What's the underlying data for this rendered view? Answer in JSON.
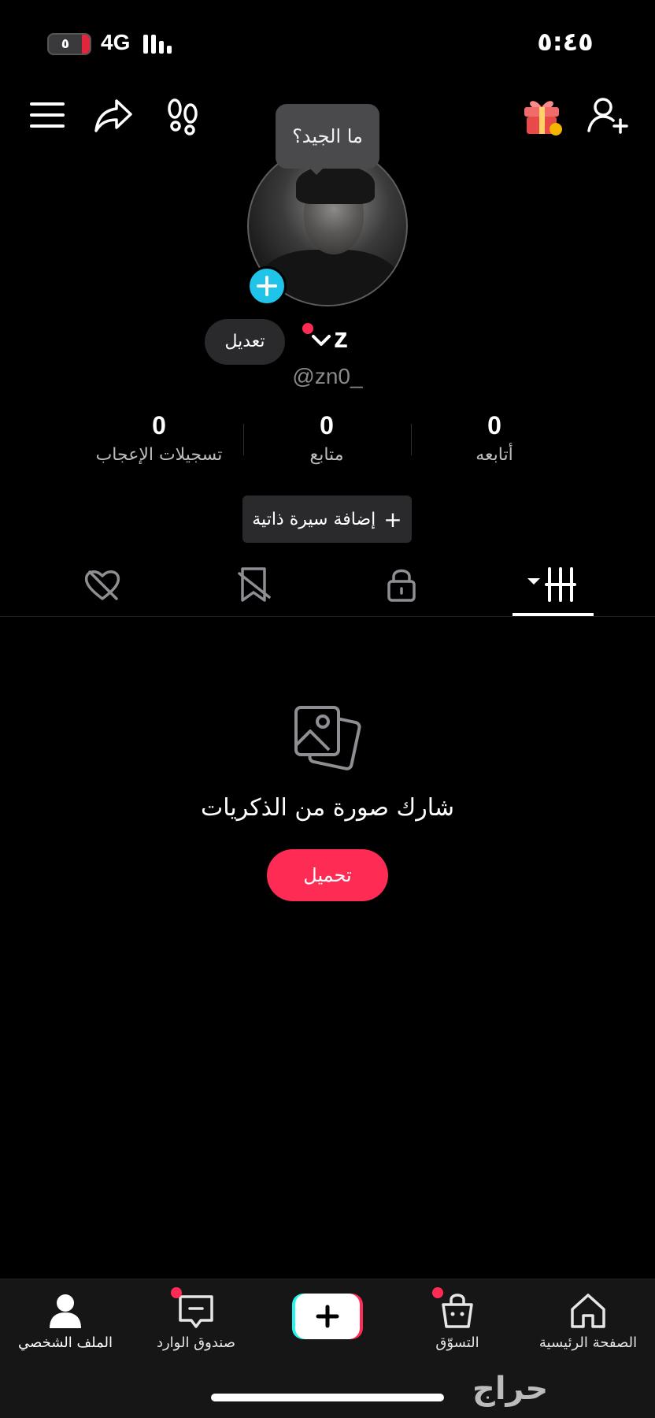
{
  "status_bar": {
    "battery": "٥",
    "network": "4G",
    "time": "٥:٤٥"
  },
  "top_bar": {
    "icons": [
      "menu-icon",
      "share-icon",
      "footprints-icon",
      "gift-icon",
      "add-friend-icon"
    ]
  },
  "profile": {
    "tooltip": "ما الجيد؟",
    "edit_label": "تعديل",
    "name": "z",
    "handle": "@zn0_",
    "stats": [
      {
        "value": "0",
        "label": "أتابعه"
      },
      {
        "value": "0",
        "label": "متابع"
      },
      {
        "value": "0",
        "label": "تسجيلات الإعجاب"
      }
    ],
    "bio_button": "إضافة سيرة ذاتية",
    "bio_button_icon": "+"
  },
  "tabs": {
    "icons": [
      "videos-grid-icon",
      "private-lock-icon",
      "favorites-hidden-icon",
      "liked-hidden-icon"
    ],
    "active": "videos-grid-icon"
  },
  "empty_state": {
    "title": "شارك صورة من الذكريات",
    "button": "تحميل"
  },
  "bottom_nav": {
    "items": [
      {
        "label": "الصفحة الرئيسية",
        "icon": "home-icon"
      },
      {
        "label": "التسوّق",
        "icon": "shop-icon"
      },
      {
        "label": "",
        "icon": "create-icon"
      },
      {
        "label": "صندوق الوارد",
        "icon": "inbox-icon"
      },
      {
        "label": "الملف الشخصي",
        "icon": "profile-icon"
      }
    ]
  },
  "watermark": "حراج",
  "colors": {
    "accent": "#fe2c55",
    "add_badge": "#20c4e8",
    "background": "#000000"
  }
}
